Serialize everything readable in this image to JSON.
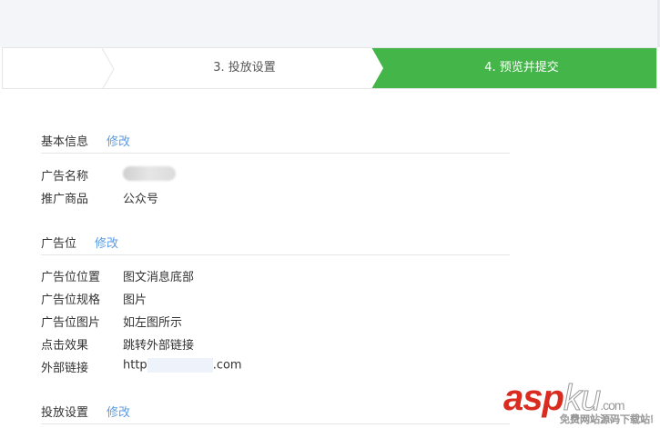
{
  "steps": {
    "step3": "3. 投放设置",
    "step4": "4. 预览并提交",
    "active_color": "#44b549"
  },
  "sections": {
    "basic": {
      "title": "基本信息",
      "edit": "修改",
      "rows": [
        {
          "label": "广告名称",
          "value": ""
        },
        {
          "label": "推广商品",
          "value": "公众号"
        }
      ]
    },
    "slot": {
      "title": "广告位",
      "edit": "修改",
      "rows": [
        {
          "label": "广告位位置",
          "value": "图文消息底部"
        },
        {
          "label": "广告位规格",
          "value": "图片"
        },
        {
          "label": "广告位图片",
          "value": "如左图所示"
        },
        {
          "label": "点击效果",
          "value": "跳转外部链接"
        },
        {
          "label": "外部链接",
          "value_prefix": "http",
          "value_suffix": ".com"
        }
      ]
    },
    "delivery": {
      "title": "投放设置",
      "edit": "修改"
    }
  },
  "watermark": {
    "main": "asp",
    "ku": "ku",
    "com": ".com",
    "sub": "免费网站源码下载站!"
  },
  "link_color": "#5b9be6"
}
